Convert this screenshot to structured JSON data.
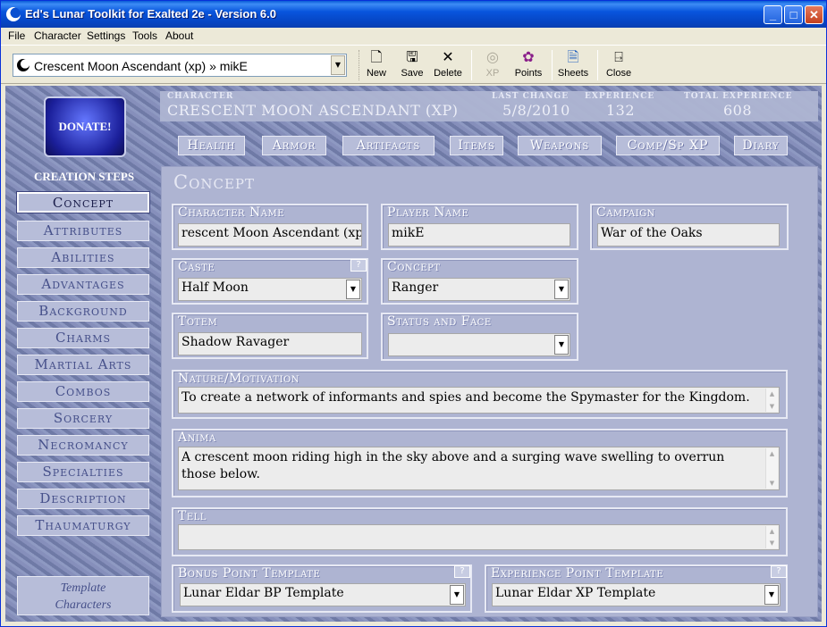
{
  "window": {
    "title": "Ed's Lunar Toolkit for Exalted 2e - Version 6.0"
  },
  "menu": [
    "File",
    "Character",
    "Settings",
    "Tools",
    "About"
  ],
  "toolbar": {
    "character_selected": "Crescent Moon Ascendant (xp) » mikE",
    "buttons": [
      {
        "label": "New",
        "icon": "new-document-icon"
      },
      {
        "label": "Save",
        "icon": "floppy-disk-icon"
      },
      {
        "label": "Delete",
        "icon": "delete-x-icon"
      },
      {
        "label": "XP",
        "icon": "xp-icon",
        "disabled": true
      },
      {
        "label": "Points",
        "icon": "points-icon"
      },
      {
        "label": "Sheets",
        "icon": "sheets-icon"
      },
      {
        "label": "Close",
        "icon": "close-door-icon"
      }
    ]
  },
  "sidebar": {
    "donate": "DONATE!",
    "creation_steps_label": "CREATION STEPS",
    "steps": [
      "Concept",
      "Attributes",
      "Abilities",
      "Advantages",
      "Background",
      "Charms",
      "Martial Arts",
      "Combos",
      "Sorcery",
      "Necromancy",
      "Specialties",
      "Description",
      "Thaumaturgy"
    ],
    "active_step": "Concept",
    "template_characters": [
      "Template",
      "Characters"
    ]
  },
  "header": {
    "character_label": "CHARACTER",
    "character_value": "CRESCENT MOON ASCENDANT (XP)",
    "last_change_label": "LAST CHANGE",
    "last_change_value": "5/8/2010",
    "experience_label": "EXPERIENCE",
    "experience_value": "132",
    "total_experience_label": "TOTAL EXPERIENCE",
    "total_experience_value": "608"
  },
  "tabs": [
    "Health",
    "Armor",
    "Artifacts",
    "Items",
    "Weapons",
    "Comp/Sp XP",
    "Diary"
  ],
  "concept": {
    "title": "Concept",
    "character_name": {
      "label": "Character Name",
      "value": "rescent Moon Ascendant (xp)"
    },
    "player_name": {
      "label": "Player Name",
      "value": "mikE"
    },
    "campaign": {
      "label": "Campaign",
      "value": "War of the Oaks"
    },
    "caste": {
      "label": "Caste",
      "value": "Half Moon",
      "help": "?"
    },
    "concept": {
      "label": "Concept",
      "value": "Ranger"
    },
    "totem": {
      "label": "Totem",
      "value": "Shadow Ravager"
    },
    "status_face": {
      "label": "Status and Face",
      "value": ""
    },
    "nature": {
      "label": "Nature/Motivation",
      "value": "To create a network of informants and spies and become the Spymaster for the Kingdom."
    },
    "anima": {
      "label": "Anima",
      "value": "A crescent moon riding high in the sky above and a surging wave swelling to overrun those below."
    },
    "tell": {
      "label": "Tell",
      "value": ""
    },
    "bonus_template": {
      "label": "Bonus Point Template",
      "value": "Lunar Eldar BP Template",
      "help": "?"
    },
    "xp_template": {
      "label": "Experience Point Template",
      "value": "Lunar Eldar XP Template",
      "help": "?"
    }
  }
}
